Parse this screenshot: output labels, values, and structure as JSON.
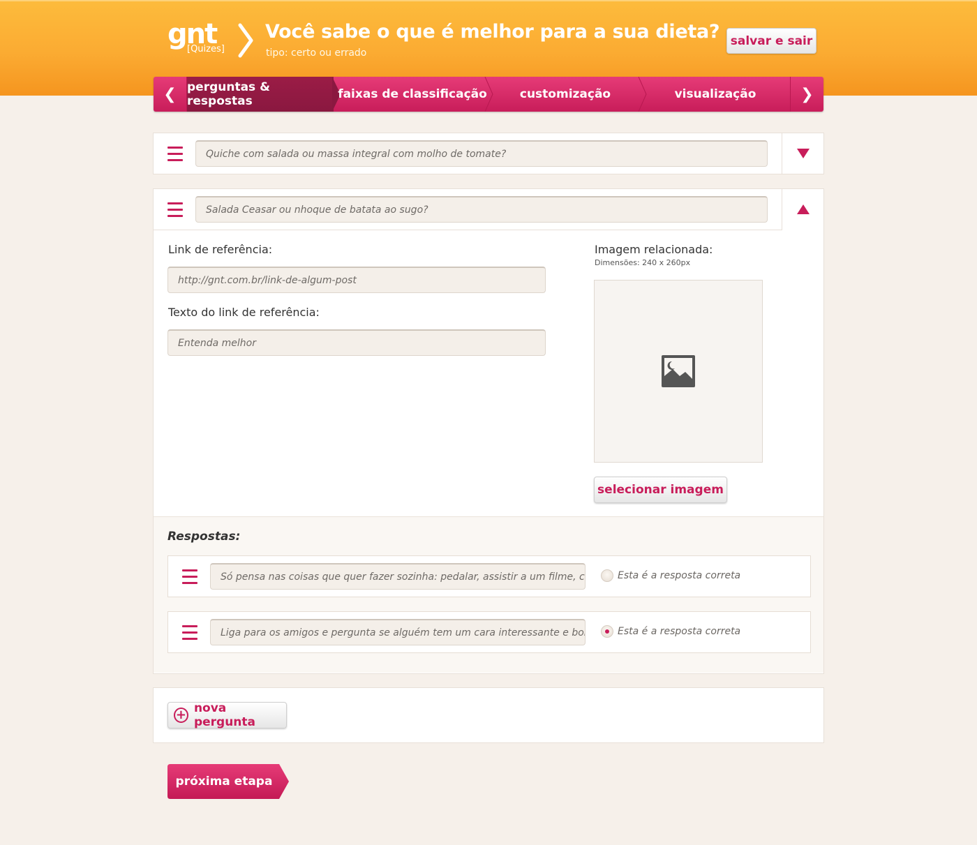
{
  "header": {
    "logo_text": "gnt",
    "logo_sub": "[Quizes]",
    "title": "Você sabe o que é melhor para a sua dieta?",
    "subtitle": "tipo: certo ou errado",
    "save_label": "salvar e sair"
  },
  "tabs": {
    "prev_icon": "chevron-left-icon",
    "next_icon": "chevron-right-icon",
    "items": [
      {
        "label": "perguntas & respostas",
        "active": true
      },
      {
        "label": "faixas de classificação",
        "active": false
      },
      {
        "label": "customização",
        "active": false
      },
      {
        "label": "visualização",
        "active": false
      }
    ]
  },
  "questions": [
    {
      "value": "Quiche com salada ou massa integral com molho de tomate?",
      "expanded": false
    },
    {
      "value": "Salada Ceasar ou nhoque de batata ao sugo?",
      "expanded": true
    }
  ],
  "detail": {
    "link_label": "Link de referência:",
    "link_placeholder": "http://gnt.com.br/link-de-algum-post",
    "link_text_label": "Texto do link de referência:",
    "link_text_placeholder": "Entenda melhor",
    "image_label": "Imagem relacionada:",
    "image_dims": "Dimensões: 240 x 260px",
    "select_image_label": "selecionar imagem"
  },
  "answers": {
    "heading": "Respostas:",
    "correct_label": "Esta é a resposta correta",
    "items": [
      {
        "value": "Só pensa nas coisas que quer fazer sozinha: pedalar, assistir a um filme, cui…",
        "correct": false
      },
      {
        "value": "Liga para os amigos e pergunta se alguém tem um cara interessante e bonit…",
        "correct": true
      }
    ]
  },
  "new_question_label": "nova pergunta",
  "next_step_label": "próxima etapa",
  "colors": {
    "accent": "#c81d5a",
    "header": "#fbab32",
    "background": "#f6f0ea"
  }
}
